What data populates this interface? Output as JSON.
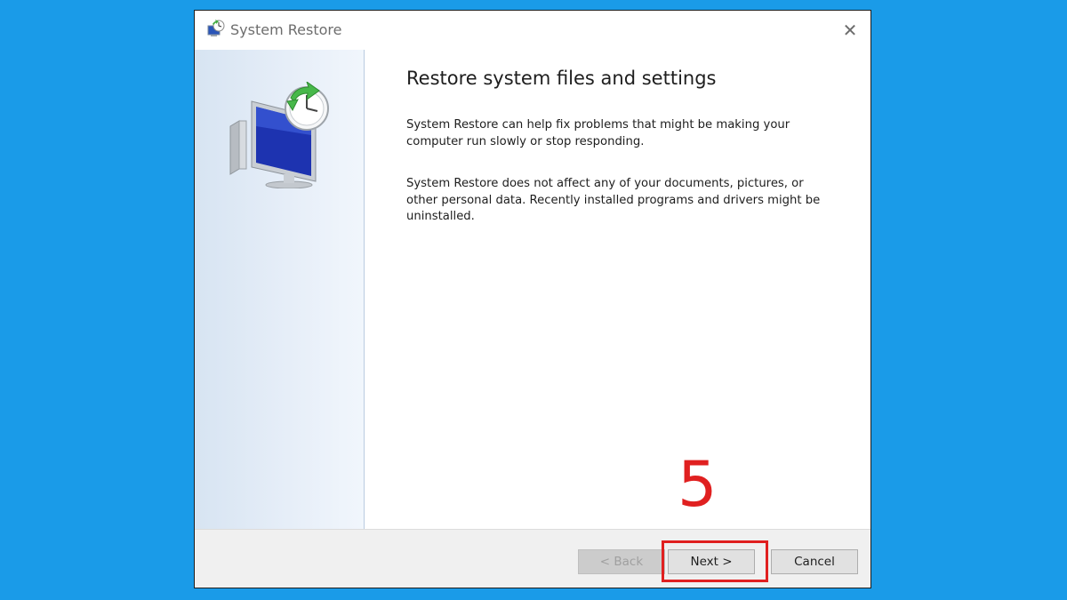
{
  "window": {
    "title": "System Restore",
    "close_glyph": "✕"
  },
  "icons": {
    "title": "system-restore-icon",
    "hero": "computer-restore-clock-icon",
    "close": "close-icon"
  },
  "content": {
    "heading": "Restore system files and settings",
    "paragraph1": "System Restore can help fix problems that might be making your computer run slowly or stop responding.",
    "paragraph2": "System Restore does not affect any of your documents, pictures, or other personal data. Recently installed programs and drivers might be uninstalled."
  },
  "buttons": {
    "back": "< Back",
    "next": "Next >",
    "cancel": "Cancel"
  },
  "annotation": {
    "step": "5",
    "color": "#e02020"
  },
  "colors": {
    "background": "#1a9be8",
    "sidebar": "#e6eef8"
  }
}
